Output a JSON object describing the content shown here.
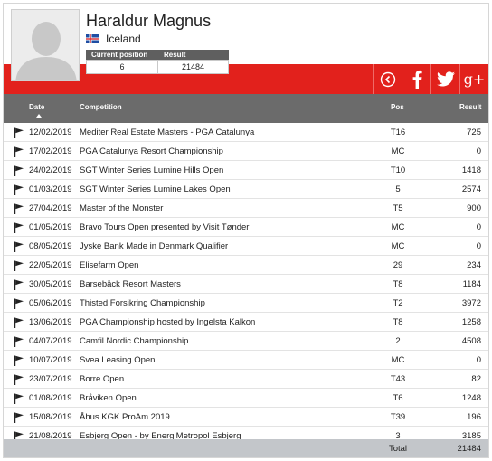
{
  "player": {
    "name": "Haraldur Magnus",
    "country": "Iceland"
  },
  "stats": {
    "current_position_label": "Current position",
    "result_label": "Result",
    "current_position": "6",
    "result": "21484"
  },
  "social": {
    "back_icon": "circle-left-icon",
    "facebook_icon": "facebook-icon",
    "twitter_icon": "twitter-icon",
    "googleplus_label": "g+"
  },
  "table": {
    "headers": {
      "date": "Date",
      "competition": "Competition",
      "pos": "Pos",
      "result": "Result"
    },
    "rows": [
      {
        "date": "12/02/2019",
        "competition": "Mediter Real Estate Masters - PGA Catalunya",
        "pos": "T16",
        "result": "725"
      },
      {
        "date": "17/02/2019",
        "competition": "PGA Catalunya Resort Championship",
        "pos": "MC",
        "result": "0"
      },
      {
        "date": "24/02/2019",
        "competition": "SGT Winter Series Lumine Hills Open",
        "pos": "T10",
        "result": "1418"
      },
      {
        "date": "01/03/2019",
        "competition": "SGT Winter Series Lumine Lakes Open",
        "pos": "5",
        "result": "2574"
      },
      {
        "date": "27/04/2019",
        "competition": "Master of the Monster",
        "pos": "T5",
        "result": "900"
      },
      {
        "date": "01/05/2019",
        "competition": "Bravo Tours Open presented by Visit Tønder",
        "pos": "MC",
        "result": "0"
      },
      {
        "date": "08/05/2019",
        "competition": "Jyske Bank Made in Denmark Qualifier",
        "pos": "MC",
        "result": "0"
      },
      {
        "date": "22/05/2019",
        "competition": "Elisefarm Open",
        "pos": "29",
        "result": "234"
      },
      {
        "date": "30/05/2019",
        "competition": "Barsebäck Resort Masters",
        "pos": "T8",
        "result": "1184"
      },
      {
        "date": "05/06/2019",
        "competition": "Thisted Forsikring Championship",
        "pos": "T2",
        "result": "3972"
      },
      {
        "date": "13/06/2019",
        "competition": "PGA Championship hosted by Ingelsta Kalkon",
        "pos": "T8",
        "result": "1258"
      },
      {
        "date": "04/07/2019",
        "competition": "Camfil Nordic Championship",
        "pos": "2",
        "result": "4508"
      },
      {
        "date": "10/07/2019",
        "competition": "Svea Leasing Open",
        "pos": "MC",
        "result": "0"
      },
      {
        "date": "23/07/2019",
        "competition": "Borre Open",
        "pos": "T43",
        "result": "82"
      },
      {
        "date": "01/08/2019",
        "competition": "Bråviken Open",
        "pos": "T6",
        "result": "1248"
      },
      {
        "date": "15/08/2019",
        "competition": "Åhus KGK ProAm 2019",
        "pos": "T39",
        "result": "196"
      },
      {
        "date": "21/08/2019",
        "competition": "Esbjerg Open - by EnergiMetropol Esbjerg",
        "pos": "3",
        "result": "3185"
      }
    ],
    "total_label": "Total",
    "total_value": "21484"
  },
  "colors": {
    "accent_red": "#e2211c",
    "header_gray": "#6b6b6b",
    "footer_gray": "#c3c6ca"
  }
}
